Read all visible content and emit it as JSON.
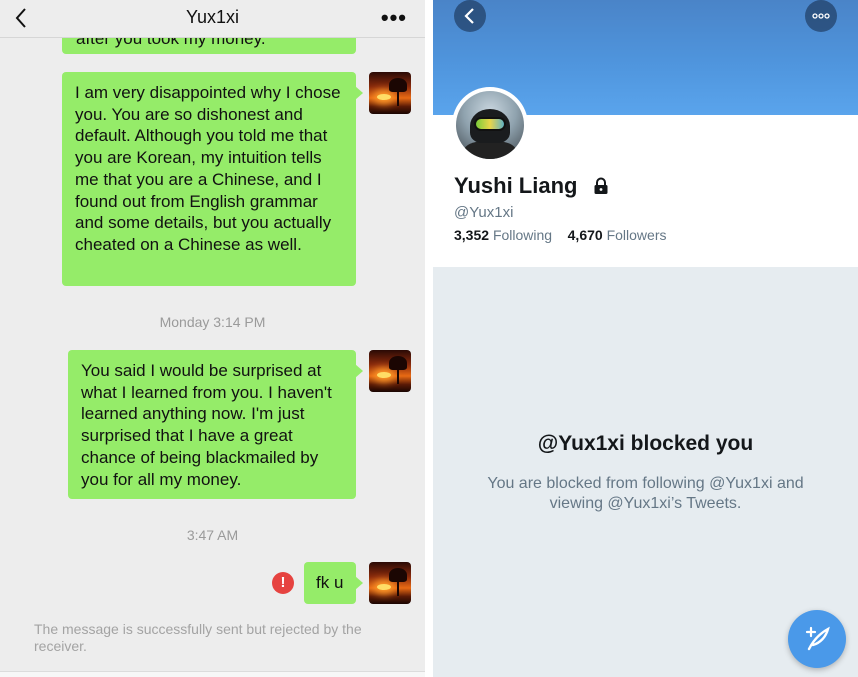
{
  "chat": {
    "title": "Yux1xi",
    "back_icon": "chevron-left-icon",
    "more_label": "•••",
    "messages": [
      {
        "text": "after you took my money."
      },
      {
        "text": "I am very disappointed why I chose you. You are so dishonest and default. Although you told me that you are Korean, my intuition tells me that you are a Chinese, and I found out from English grammar and some details, but you actually cheated on a Chinese as well."
      },
      {
        "text": "You said I would be surprised at what I learned from you. I haven't learned anything now. I'm just surprised that I have a great chance of being blackmailed by you for all my money."
      },
      {
        "text": "fk u"
      }
    ],
    "timestamps": [
      "Monday 3:14 PM",
      "3:47 AM"
    ],
    "error_mark": "!",
    "system_note": "The message is successfully sent but rejected by the receiver.",
    "bubble_color": "#95ec69",
    "error_color": "#e64340"
  },
  "profile": {
    "name": "Yushi Liang",
    "handle": "@Yux1xi",
    "following_count": "3,352",
    "following_label": "Following",
    "followers_count": "4,670",
    "followers_label": "Followers",
    "blocked_title": "@Yux1xi blocked you",
    "blocked_desc": "You are blocked from following @Yux1xi and viewing @Yux1xi’s Tweets.",
    "accent_color": "#4a99e9",
    "icons": {
      "back": "chevron-left-icon",
      "more": "more-dots-icon",
      "lock": "lock-icon",
      "compose": "compose-tweet-icon"
    }
  }
}
